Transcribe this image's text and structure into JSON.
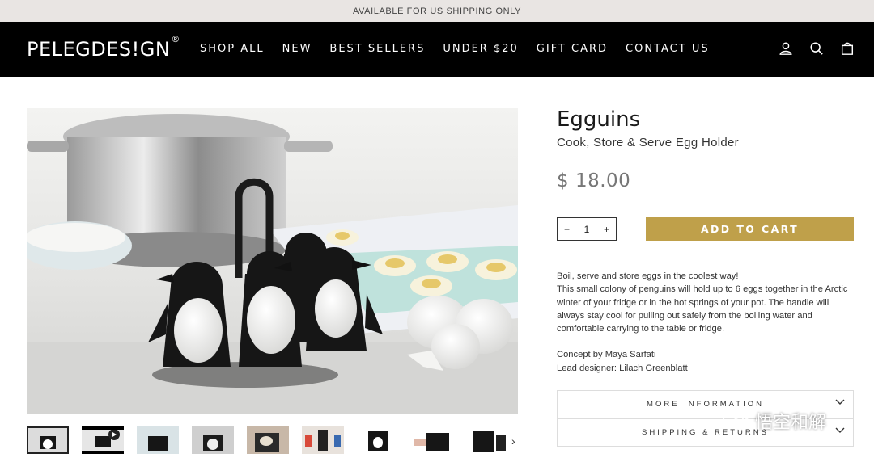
{
  "announcement": "AVAILABLE FOR US SHIPPING ONLY",
  "header": {
    "logo": "PELEGDES!GN",
    "logo_mark": "®",
    "nav": [
      "SHOP ALL",
      "NEW",
      "BEST SELLERS",
      "UNDER $20",
      "GIFT CARD",
      "CONTACT US"
    ],
    "icons": [
      "user-icon",
      "search-icon",
      "cart-icon"
    ]
  },
  "product": {
    "title": "Egguins",
    "subtitle": "Cook, Store & Serve Egg Holder",
    "price": "$ 18.00",
    "quantity": {
      "minus": "−",
      "value": "1",
      "plus": "+"
    },
    "add_to_cart": "ADD TO CART",
    "description": [
      "Boil, serve and store eggs in the coolest way!",
      "This small colony of penguins will hold up to 6 eggs together in the Arctic winter of your fridge or in the hot springs of your pot. The handle will always stay cool for pulling out safely from the boiling water and comfortable carrying to the table or fridge."
    ],
    "concept": "Concept by Maya Sarfati",
    "designer": "Lead designer: Lilach Greenblatt",
    "accordions": [
      "MORE INFORMATION",
      "SHIPPING & RETURNS"
    ]
  },
  "gallery": {
    "thumb_count": 9,
    "next_arrow": "›"
  },
  "watermark": "悟空和解",
  "colors": {
    "header_bg": "#000000",
    "announce_bg": "#e9e5e3",
    "accent": "#bfa04a",
    "price": "#777777"
  }
}
